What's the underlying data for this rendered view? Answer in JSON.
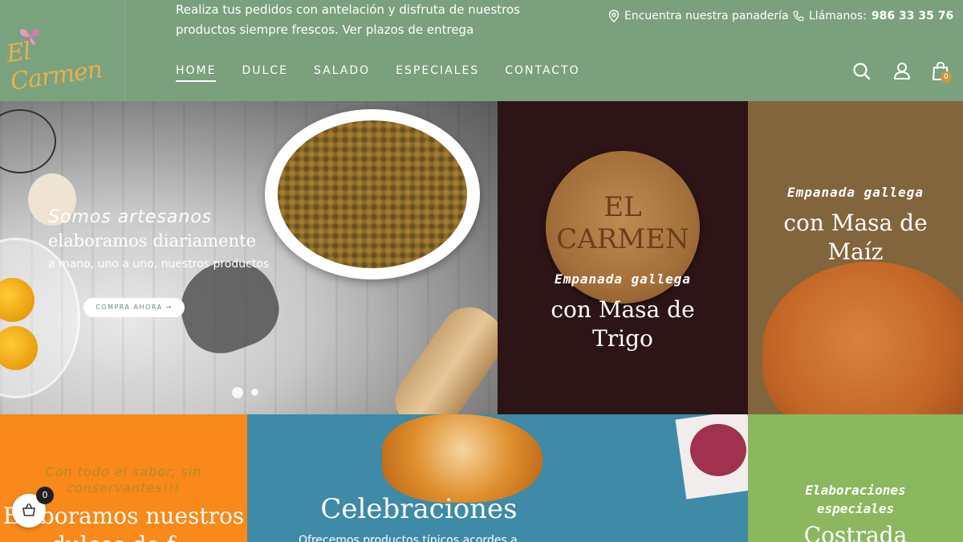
{
  "header": {
    "logo_text": "El Carmen",
    "promo_line1": "Realiza tus pedidos con antelación y disfruta de nuestros",
    "promo_line2": "productos siempre frescos. Ver plazos de entrega",
    "find_store": "Encuentra nuestra panadería",
    "call_label": "Llámanos:",
    "phone": "986 33 35 76",
    "cart_count": "0",
    "nav": [
      "HOME",
      "DULCE",
      "SALADO",
      "ESPECIALES",
      "CONTACTO"
    ],
    "active_nav": "HOME"
  },
  "hero": {
    "line1": "Somos artesanos",
    "line2": "elaboramos diariamente",
    "line3": "a mano, uno a uno, nuestros productos",
    "button": "COMPRA AHORA →",
    "slides": 2,
    "active_slide": 1
  },
  "trigo": {
    "stamp": "EL CARMEN",
    "subtitle": "Empanada gallega",
    "title_line1": "con Masa de",
    "title_line2": "Trigo"
  },
  "maiz": {
    "subtitle": "Empanada gallega",
    "title_line1": "con Masa de",
    "title_line2": "Maíz"
  },
  "orange": {
    "tag_line1": "Con todo el sabor, sin",
    "tag_line2": "conservantes!!!",
    "title_line1": "Elaboramos nuestros",
    "title_line2": "dulces de f..."
  },
  "blue": {
    "title": "Celebraciones",
    "subtitle": "Ofrecemos productos típicos acordes a..."
  },
  "green": {
    "tag_line1": "Elaboraciones",
    "tag_line2": "especiales",
    "title": "Costrada"
  },
  "floating_cart": {
    "count": "0"
  },
  "colors": {
    "header_bg": "#7aa07e",
    "logo_color": "#e8b04a",
    "trigo_bg": "#2d1417",
    "maiz_bg": "#83653d",
    "orange_bg": "#f8891a",
    "blue_bg": "#3f8aa6",
    "green_bg": "#8bb75f"
  }
}
